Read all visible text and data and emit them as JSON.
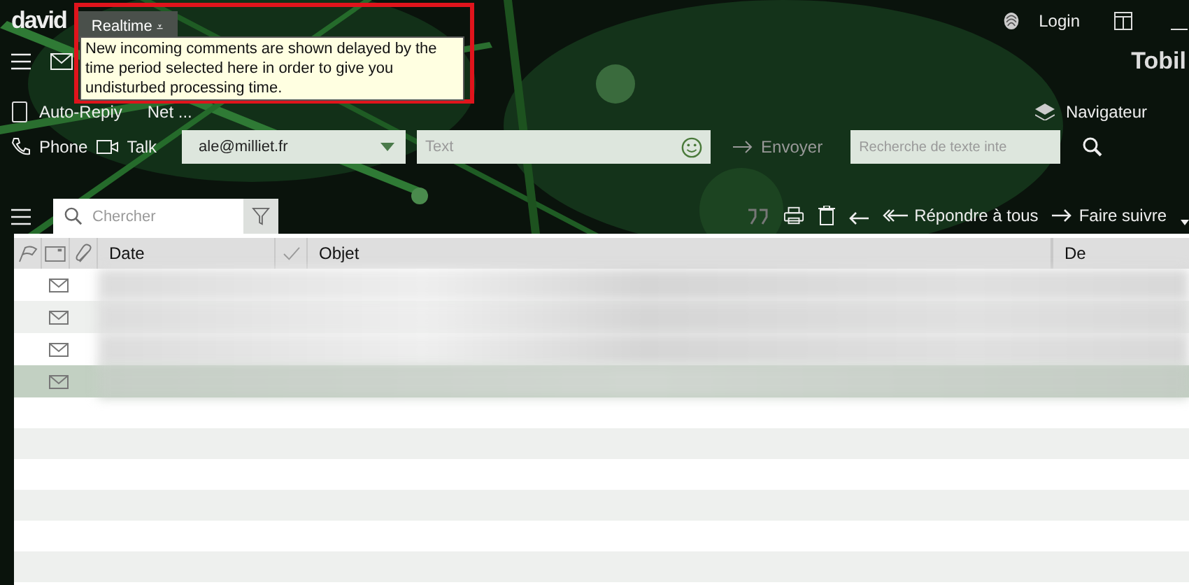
{
  "title_bar": {
    "logo": "david",
    "tab": "Realtime",
    "tab_caret": "⩡",
    "login": "Login",
    "brand": "Tobil"
  },
  "tooltip": {
    "text": "New incoming comments are shown delayed by the time period selected here in order to give you undisturbed processing time.",
    "highlighted": true
  },
  "toolbar": {
    "items": [
      "Auto-Repiy",
      "Net ...",
      "Navigateur"
    ]
  },
  "compose": {
    "phone": "Phone",
    "talk": "Talk",
    "account": "ale@milliet.fr",
    "text_placeholder": "Text",
    "send": "Envoyer",
    "search_placeholder": "Recherche de texte inte"
  },
  "list_toolbar": {
    "search_placeholder": "Chercher",
    "reply_all": "Répondre à tous",
    "forward": "Faire suivre"
  },
  "table": {
    "columns": [
      "Date",
      "Objet",
      "De"
    ],
    "rows": [
      {
        "selected": false
      },
      {
        "selected": false
      },
      {
        "selected": false
      },
      {
        "selected": true
      }
    ]
  }
}
